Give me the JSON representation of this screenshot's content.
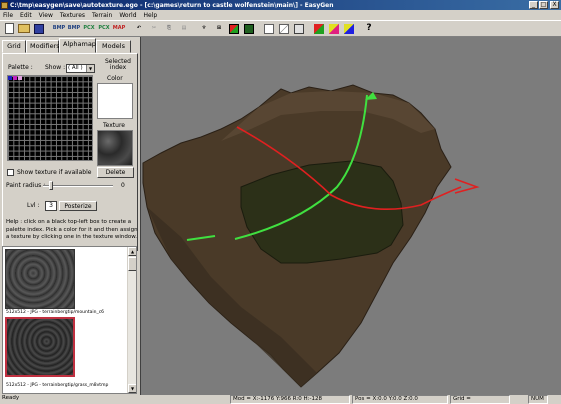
{
  "window": {
    "title": "C:\\tmp\\easygen\\save\\autotexture.ego - [c:\\games\\return to castle wolfenstein\\main\\] - EasyGen",
    "minimize": "_",
    "maximize": "□",
    "close": "X"
  },
  "menu": [
    "File",
    "Edit",
    "View",
    "Textures",
    "Terrain",
    "World",
    "Help"
  ],
  "toolbar": [
    {
      "icon": "new-file-icon"
    },
    {
      "icon": "open-folder-icon"
    },
    {
      "icon": "save-disk-icon"
    },
    {
      "label": "BMP",
      "icon": "export-bmp-icon"
    },
    {
      "label": "BMP",
      "icon": "import-bmp-icon"
    },
    {
      "label": "PCX",
      "icon": "export-pcx-icon"
    },
    {
      "label": "PCX",
      "icon": "import-pcx-icon"
    },
    {
      "label": "MAP",
      "icon": "export-map-icon"
    },
    {
      "icon": "undo-icon"
    },
    {
      "icon": "cut-icon"
    },
    {
      "icon": "copy-icon"
    },
    {
      "icon": "paste-icon"
    },
    {
      "icon": "tool-icon"
    },
    {
      "icon": "grid-icon"
    },
    {
      "icon": "color-icon"
    },
    {
      "icon": "texture-icon"
    },
    {
      "icon": "select-icon"
    },
    {
      "icon": "view-icon"
    },
    {
      "icon": "box-icon"
    },
    {
      "icon": "alpha-icon"
    },
    {
      "icon": "alpha2-icon"
    },
    {
      "icon": "alpha3-icon"
    },
    {
      "label": "?",
      "icon": "help-icon"
    }
  ],
  "tabs": [
    {
      "label": "Grid",
      "active": false
    },
    {
      "label": "Modifiers",
      "active": false
    },
    {
      "label": "Alphamap",
      "active": true
    },
    {
      "label": "Models",
      "active": false
    }
  ],
  "alphamap": {
    "palette_label": "Palette :",
    "show_label": "Show :",
    "show_value": "( All )",
    "selected_index_label": "Selected index",
    "color_label": "Color",
    "texture_label": "Texture",
    "show_texture_checkbox": "Show texture if available",
    "delete_button": "Delete",
    "paint_radius_label": "Paint radius :",
    "paint_radius_value": "0",
    "lvl_label": "Lvl :",
    "lvl_value": "3",
    "posterize_button": "Posterize",
    "help_text": "Help : click on a black top-left box to create a palette index. Pick a color for it and then assign a texture by clicking one in the texture window."
  },
  "textures": [
    {
      "caption": "512x512 - JPG - terrainbergtip/mountain_c6",
      "selected": false
    },
    {
      "caption": "512x512 - JPG - terrainbergtip/grass_m8vtmp",
      "selected": true
    }
  ],
  "viewport": {
    "background": "#7c7c7c",
    "terrain_color": "#4a3a28",
    "center_color": "#2c3018",
    "curve_green": "#40e040",
    "curve_red": "#e02020"
  },
  "status": {
    "ready": "Ready",
    "mod": "Mod = X:-1176 Y:966 R:0 H:-128",
    "pos": "Pos = X:0.0 Y:0.0 Z:0.0",
    "grid": "Grid =",
    "num": "NUM"
  }
}
